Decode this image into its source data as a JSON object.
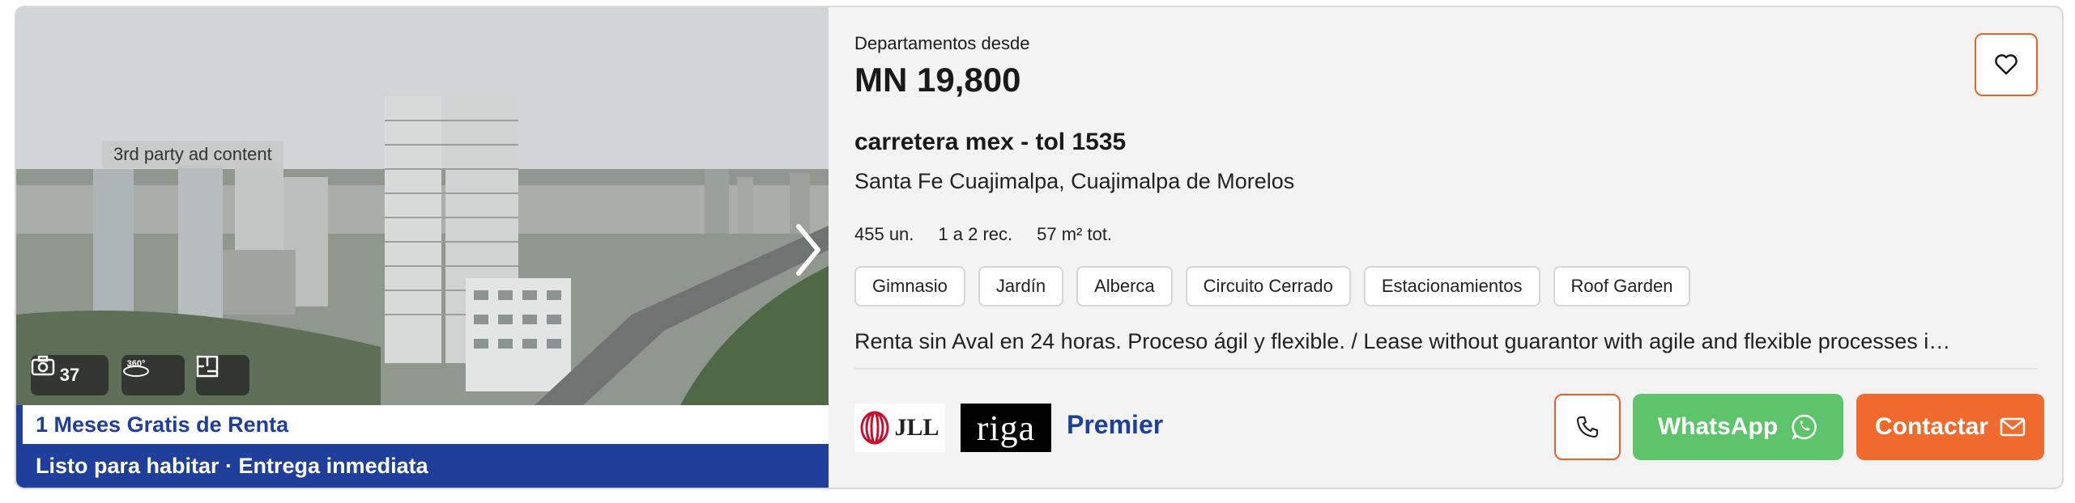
{
  "media": {
    "ad_label": "3rd party ad content",
    "photo_count": "37",
    "icons": [
      "camera-icon",
      "360-view-icon",
      "floor-plan-icon",
      "chevron-right-icon"
    ],
    "promo_text": "1 Meses Gratis de Renta",
    "status_text": "Listo para habitar · Entrega inmediata",
    "view_360_label": "360°"
  },
  "listing": {
    "price_label": "Departamentos desde",
    "price": "MN 19,800",
    "address": "carretera mex - tol 1535",
    "location": "Santa Fe Cuajimalpa, Cuajimalpa de Morelos",
    "features": [
      "455 un.",
      "1 a 2 rec.",
      "57 m² tot."
    ],
    "amenities": [
      "Gimnasio",
      "Jardín",
      "Alberca",
      "Circuito Cerrado",
      "Estacionamientos",
      "Roof Garden"
    ],
    "description": "Renta sin Aval en 24 horas. Proceso ágil y flexible. / Lease without guarantor with agile and flexible processes i…"
  },
  "publisher": {
    "logo_jll": "JLL",
    "logo_riga": "riga",
    "tier": "Premier"
  },
  "actions": {
    "favorite_icon": "heart-icon",
    "phone_icon": "phone-icon",
    "whatsapp_label": "WhatsApp",
    "contact_label": "Contactar"
  },
  "colors": {
    "accent_orange": "#ef6a2c",
    "whatsapp_green": "#5ec46b",
    "brand_blue": "#1f3f9a"
  }
}
